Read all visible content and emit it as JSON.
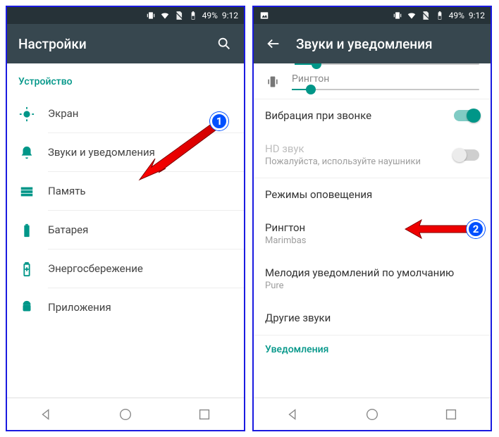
{
  "statusbar": {
    "battery": "49%",
    "time": "9:12"
  },
  "left": {
    "title": "Настройки",
    "section": "Устройство",
    "items": [
      {
        "label": "Экран"
      },
      {
        "label": "Звуки и уведомления"
      },
      {
        "label": "Память"
      },
      {
        "label": "Батарея"
      },
      {
        "label": "Энергосбережение"
      },
      {
        "label": "Приложения"
      }
    ]
  },
  "right": {
    "title": "Звуки и уведомления",
    "ringtone_label": "Рингтон",
    "vibrate_label": "Вибрация при звонке",
    "hd_label": "HD звук",
    "hd_sub": "Пожалуйста, используйте наушники",
    "alert_modes": "Режимы оповещения",
    "ringtone_row": "Рингтон",
    "ringtone_value": "Marimbas",
    "notif_row": "Мелодия уведомлений по умолчанию",
    "notif_value": "Pure",
    "other_sounds": "Другие звуки",
    "notifications_section": "Уведомления"
  },
  "badges": {
    "one": "1",
    "two": "2"
  }
}
